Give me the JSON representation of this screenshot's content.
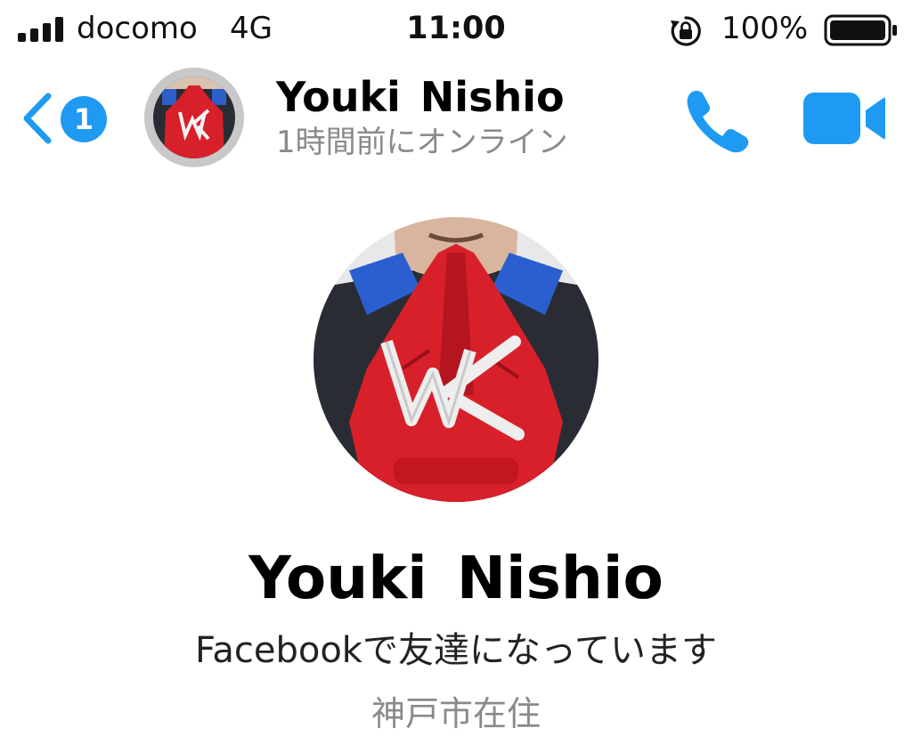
{
  "status_bar": {
    "carrier": "docomo",
    "network": "4G",
    "time": "11:00",
    "battery_percent": "100%",
    "icons": [
      "signal-bars-icon",
      "rotation-lock-icon",
      "battery-full-icon"
    ]
  },
  "header": {
    "unread_count": "1",
    "name": "Youki  Nishio",
    "status": "1時間前にオンライン",
    "icons": [
      "back-chevron-icon",
      "phone-icon",
      "video-camera-icon"
    ]
  },
  "profile": {
    "name": "Youki  Nishio",
    "friend_status": "Facebookで友達になっています",
    "location": "神戸市在住"
  },
  "colors": {
    "accent": "#1e9af2",
    "secondary_text": "#8a8a8a",
    "glove_red": "#d8202a"
  }
}
